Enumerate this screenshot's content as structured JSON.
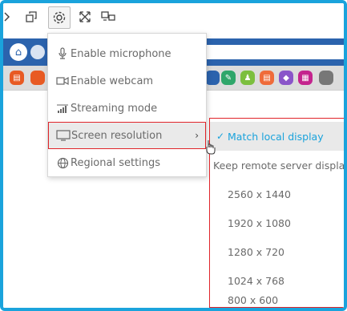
{
  "menu": {
    "items": [
      {
        "label": "Enable microphone",
        "icon": "microphone-icon"
      },
      {
        "label": "Enable webcam",
        "icon": "webcam-icon"
      },
      {
        "label": "Streaming mode",
        "icon": "signal-icon"
      },
      {
        "label": "Screen resolution",
        "icon": "monitor-icon",
        "selected": true,
        "has_submenu": true
      },
      {
        "label": "Regional settings",
        "icon": "globe-icon"
      }
    ]
  },
  "submenu": {
    "items": [
      {
        "label": "Match local display",
        "checked": true
      },
      {
        "label": "Keep remote server display"
      },
      {
        "label": "2560 x 1440"
      },
      {
        "label": "1920 x 1080"
      },
      {
        "label": "1280 x 720"
      },
      {
        "label": "1024 x 768"
      },
      {
        "label": "800 x 600"
      }
    ]
  },
  "colors": {
    "frame": "#1aa3dc",
    "highlight_border": "#e0242a",
    "browser_bar": "#2b63ad",
    "accent": "#1aa3dc"
  },
  "bookmark_colors": [
    "#e85a23",
    "#e85a23",
    "#2b63ad",
    "#2fa66a",
    "#7cbf3f",
    "#ef6b3a",
    "#8a55c9",
    "#c4248e",
    "#777777"
  ]
}
